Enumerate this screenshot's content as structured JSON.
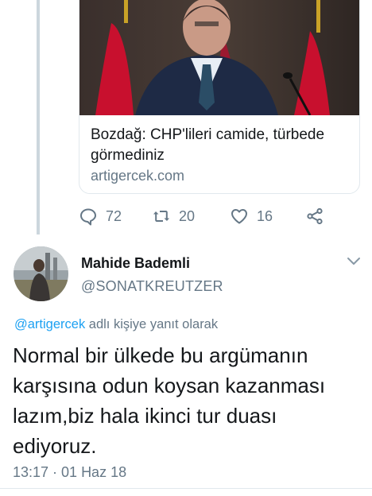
{
  "link_card": {
    "title": "Bozdağ: CHP'lileri camide, türbede görmediniz",
    "domain": "artigercek.com",
    "image_icon": "news-photo"
  },
  "parent_actions": {
    "reply_count": "72",
    "retweet_count": "20",
    "like_count": "16",
    "reply_icon": "reply-icon",
    "retweet_icon": "retweet-icon",
    "like_icon": "heart-icon",
    "share_icon": "share-icon"
  },
  "tweet": {
    "author_name": "Mahide Bademli",
    "author_handle": "@SONATKREUTZER",
    "reply_mention": "@artigercek",
    "reply_suffix": " adlı kişiye yanıt olarak",
    "text": "Normal bir ülkede bu argümanın karşısına odun koysan kazanması lazım,biz hala ikinci tur duası ediyoruz.",
    "timestamp": "13:17 · 01 Haz 18",
    "menu_icon": "chevron-down-icon"
  },
  "colors": {
    "accent": "#1da1f2",
    "secondary_text": "#657786",
    "primary_text": "#14171a",
    "border": "#e1e8ed"
  }
}
